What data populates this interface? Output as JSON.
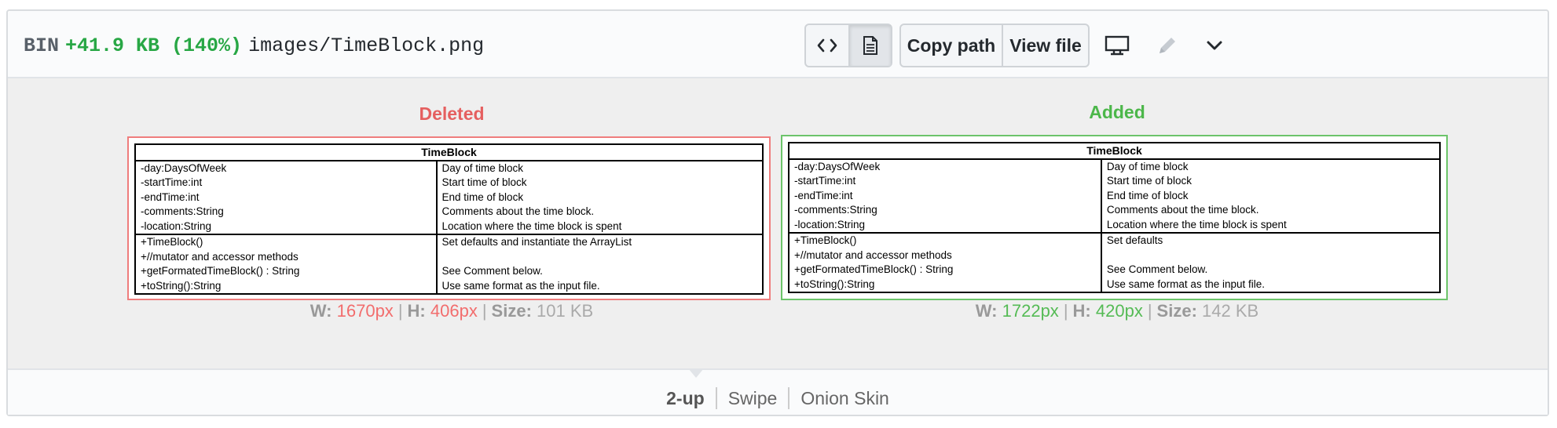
{
  "file_header": {
    "type_label": "BIN",
    "size_change": "+41.9 KB (140%)",
    "path": "images/TimeBlock.png",
    "copy_path_label": "Copy path",
    "view_file_label": "View file"
  },
  "deleted": {
    "label": "Deleted",
    "width_value": "1670px",
    "height_value": "406px",
    "size_value": "101 KB",
    "diagram": {
      "title": "TimeBlock",
      "attributes": [
        "-day:DaysOfWeek",
        "-startTime:int",
        "-endTime:int",
        "-comments:String",
        "-location:String"
      ],
      "attribute_notes": [
        "Day of time block",
        "Start time of block",
        "End time of block",
        "Comments about the time block.",
        "Location where the time block is spent"
      ],
      "methods": [
        "+TimeBlock()",
        "+//mutator and accessor methods",
        "+getFormatedTimeBlock() : String",
        "+toString():String"
      ],
      "method_notes": [
        "Set defaults and instantiate the ArrayList",
        "",
        "See Comment below.",
        "Use same format as the input file."
      ]
    }
  },
  "added": {
    "label": "Added",
    "width_value": "1722px",
    "height_value": "420px",
    "size_value": "142 KB",
    "diagram": {
      "title": "TimeBlock",
      "attributes": [
        "-day:DaysOfWeek",
        "-startTime:int",
        "-endTime:int",
        "-comments:String",
        "-location:String"
      ],
      "attribute_notes": [
        "Day of time block",
        "Start time of block",
        "End time of block",
        "Comments about the time block.",
        "Location where the time block is spent"
      ],
      "methods": [
        "+TimeBlock()",
        "+//mutator and accessor methods",
        "+getFormatedTimeBlock() : String",
        "+toString():String"
      ],
      "method_notes": [
        "Set defaults",
        "",
        "See Comment below.",
        "Use same format as the input file."
      ]
    }
  },
  "meta_labels": {
    "w": "W:",
    "h": "H:",
    "size": "Size:",
    "sep": "|"
  },
  "view_modes": [
    "2-up",
    "Swipe",
    "Onion Skin"
  ],
  "active_view_mode": "2-up",
  "icons": {
    "code": "code-icon",
    "file": "file-icon",
    "desktop": "device-desktop-icon",
    "pencil": "pencil-icon",
    "chevron": "chevron-down-icon"
  },
  "colors": {
    "deleted": "#e55f5f",
    "added": "#4cb74a"
  }
}
